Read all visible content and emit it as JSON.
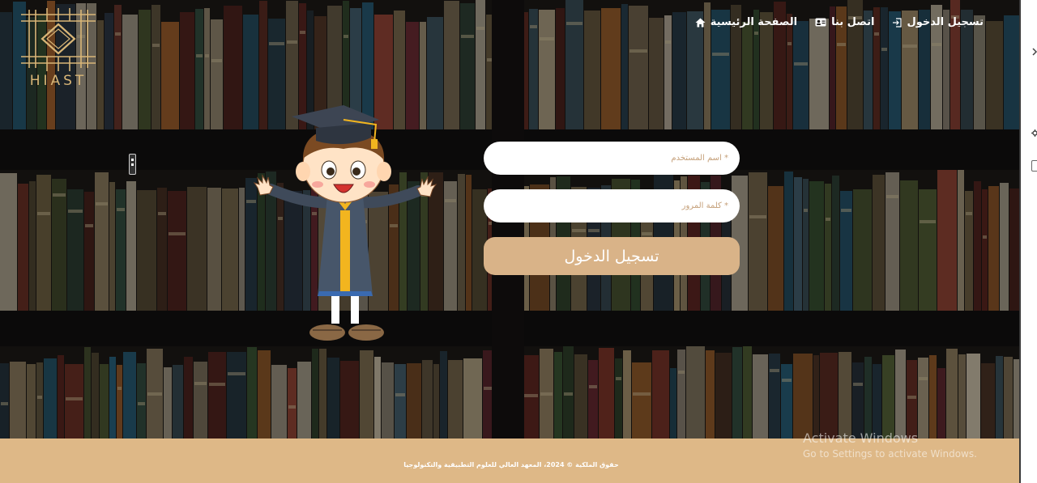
{
  "brand": {
    "logo_text": "HIAST"
  },
  "nav": {
    "items": [
      {
        "label": "تسجيل الدخول",
        "icon": "login-icon"
      },
      {
        "label": "اتصل بنا",
        "icon": "contact-card-icon"
      },
      {
        "label": "الصفحة الرئيسية",
        "icon": "home-icon"
      }
    ]
  },
  "form": {
    "username_placeholder": "* اسم المستخدم",
    "password_placeholder": "* كلمة المرور",
    "submit_label": "تسجيل الدخول"
  },
  "footer": {
    "text": "حقوق الملكية © 2024، المعهد العالي للعلوم التطبيقية والتكنولوجيا"
  },
  "watermark": {
    "line1": "Activate Windows",
    "line2": "Go to Settings to activate Windows."
  },
  "colors": {
    "accent": "#d9b388",
    "footer": "#deb887",
    "logo": "#d9b677"
  }
}
